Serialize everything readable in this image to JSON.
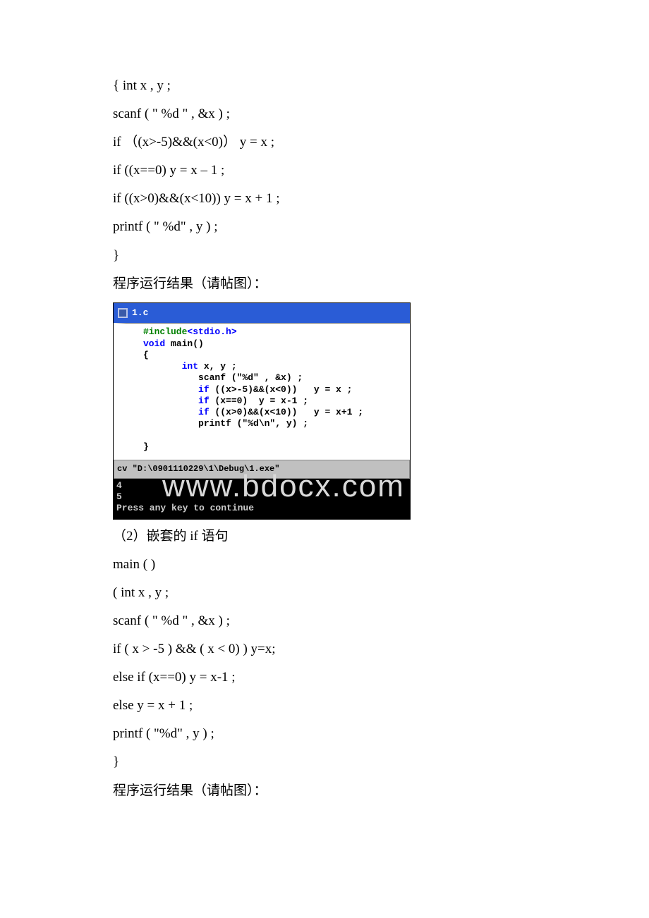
{
  "watermark": "www.bdocx.com",
  "block1": {
    "l1": "{ int x , y ;",
    "l2": "scanf ( \" %d \" , &x ) ;",
    "l3": "if （(x>-5)&&(x<0)） y = x ;",
    "l4": "if  ((x==0) y = x – 1 ;",
    "l5": "if  ((x>0)&&(x<10)) y = x + 1 ;",
    "l6": "printf ( \" %d\" , y ) ;",
    "l7": "}",
    "caption": "程序运行结果（请帖图）："
  },
  "ide1": {
    "title": "1.c",
    "code_plain": "#include<stdio.h>\nvoid main()\n{\n       int x, y ;\n          scanf (\"%d\" , &x) ;\n          if ((x>-5)&&(x<0))   y = x ;\n          if (x==0)  y = x-1 ;\n          if ((x>0)&&(x<10))   y = x+1 ;\n          printf (\"%d\\n\", y) ;\n\n}",
    "console_path": "cv \"D:\\0901110229\\1\\Debug\\1.exe\"",
    "console_body": "4\n5\nPress any key to continue"
  },
  "section2_title": "（2）嵌套的 if 语句",
  "block2": {
    "l1": "main ( )",
    "l2": "( int x , y ;",
    "l3": "scanf ( \" %d \" , &x ) ;",
    "l4": "if ( x > -5 ) && ( x < 0) ) y=x;",
    "l5": "else if (x==0) y = x-1 ;",
    "l6": " else y = x + 1 ;",
    "l7": "printf ( \"%d\" , y ) ;",
    "l8": " }",
    "caption": "程序运行结果（请帖图）："
  }
}
